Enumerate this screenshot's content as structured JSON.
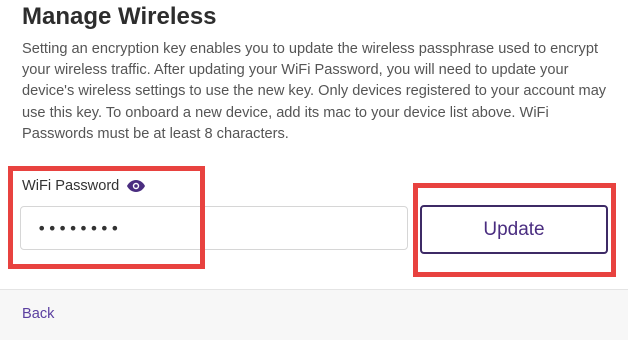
{
  "section": {
    "title": "Manage Wireless",
    "description": "Setting an encryption key enables you to update the wireless passphrase used to encrypt your wireless traffic. After updating your WiFi Password, you will need to update your device's wireless settings to use the new key. Only devices registered to your account may use this key. To onboard a new device, add its mac to your device list above. WiFi Passwords must be at least 8 characters."
  },
  "password_field": {
    "label": "WiFi Password",
    "value": "••••••••",
    "toggle_icon": "eye-icon"
  },
  "update_button": {
    "label": "Update"
  },
  "footer": {
    "back_label": "Back"
  },
  "colors": {
    "accent": "#4a2d80",
    "highlight": "#e8423f",
    "footer_bg": "#f7f7f7"
  }
}
